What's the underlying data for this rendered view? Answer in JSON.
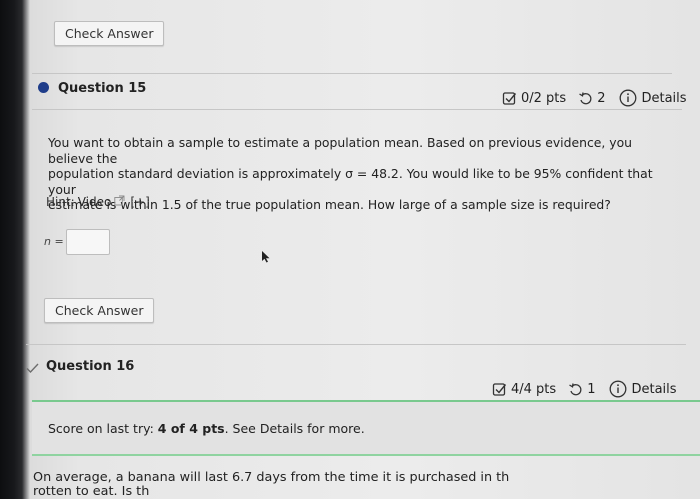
{
  "top_check_answer": "Check Answer",
  "q15": {
    "title": "Question 15",
    "pts": "0/2 pts",
    "retries": "2",
    "details": "Details",
    "body_line1": "You want to obtain a sample to estimate a population mean. Based on previous evidence, you believe the",
    "body_line2": "population standard deviation is approximately σ = 48.2. You would like to be 95% confident that your",
    "body_line3": "estimate is within 1.5 of the true population mean. How large of a sample size is required?",
    "hint_label": "Hint:",
    "hint_link": "Video",
    "hint_expand": "[+]",
    "answer_label": "n =",
    "answer_value": "",
    "check_answer": "Check Answer"
  },
  "q16": {
    "title": "Question 16",
    "pts": "4/4 pts",
    "retries": "1",
    "details": "Details",
    "score_prefix": "Score on last try: ",
    "score_value": "4 of 4 pts",
    "score_suffix": ". See Details for more.",
    "body_line1": "On average, a banana will last 6.7 days from the time it is purchased in th",
    "body_line2": "rotten to eat. Is th"
  },
  "colors": {
    "bullet_current": "#1f3d8a",
    "check_mark": "#6d6d6d",
    "score_border": "#79c98e"
  }
}
